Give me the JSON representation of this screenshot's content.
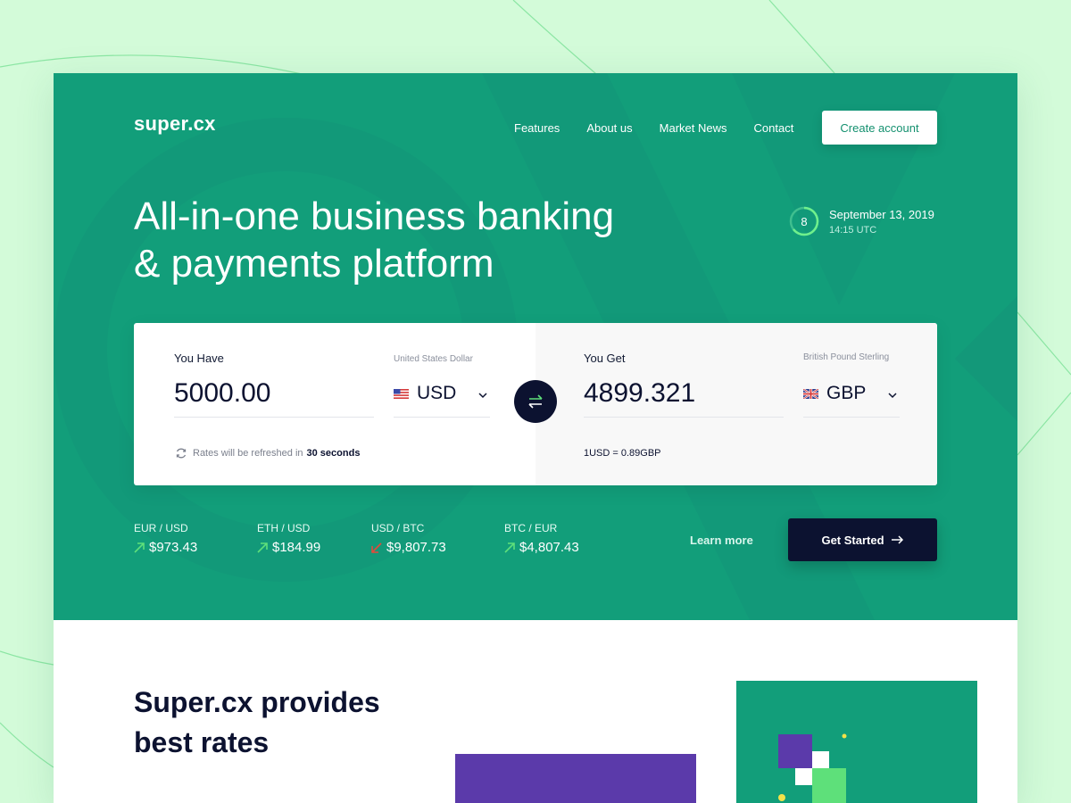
{
  "brand": {
    "logo": "super.cx"
  },
  "nav": {
    "items": [
      "Features",
      "About us",
      "Market News",
      "Contact"
    ],
    "cta": "Create account"
  },
  "hero": {
    "headline_line1": "All-in-one business banking",
    "headline_line2": "& payments platform"
  },
  "clock": {
    "countdown": "8",
    "date": "September 13, 2019",
    "time": "14:15 UTC"
  },
  "converter": {
    "have": {
      "label": "You Have",
      "amount": "5000.00",
      "currency_name": "United States Dollar",
      "currency_code": "USD",
      "flag_icon": "us-flag-icon"
    },
    "get": {
      "label": "You Get",
      "amount": "4899.321",
      "currency_name": "British Pound Sterling",
      "currency_code": "GBP",
      "flag_icon": "uk-flag-icon"
    },
    "refresh_text": "Rates will be refreshed in",
    "refresh_value": "30 seconds",
    "rate_text": "1USD = 0.89GBP"
  },
  "ticker": [
    {
      "pair": "EUR / USD",
      "value": "$973.43",
      "trend": "up"
    },
    {
      "pair": "ETH / USD",
      "value": "$184.99",
      "trend": "up"
    },
    {
      "pair": "USD / BTC",
      "value": "$9,807.73",
      "trend": "down"
    },
    {
      "pair": "BTC / EUR",
      "value": "$4,807.43",
      "trend": "up"
    }
  ],
  "actions": {
    "learn_more": "Learn more",
    "get_started": "Get Started"
  },
  "section": {
    "heading_line1": "Super.cx provides",
    "heading_line2": "best rates"
  },
  "colors": {
    "hero_bg": "#129e7a",
    "dark_navy": "#0c1230",
    "up": "#5ee07a",
    "down": "#e14b3b",
    "purple": "#5b3aaa",
    "page_bg": "#d3fbd9"
  }
}
